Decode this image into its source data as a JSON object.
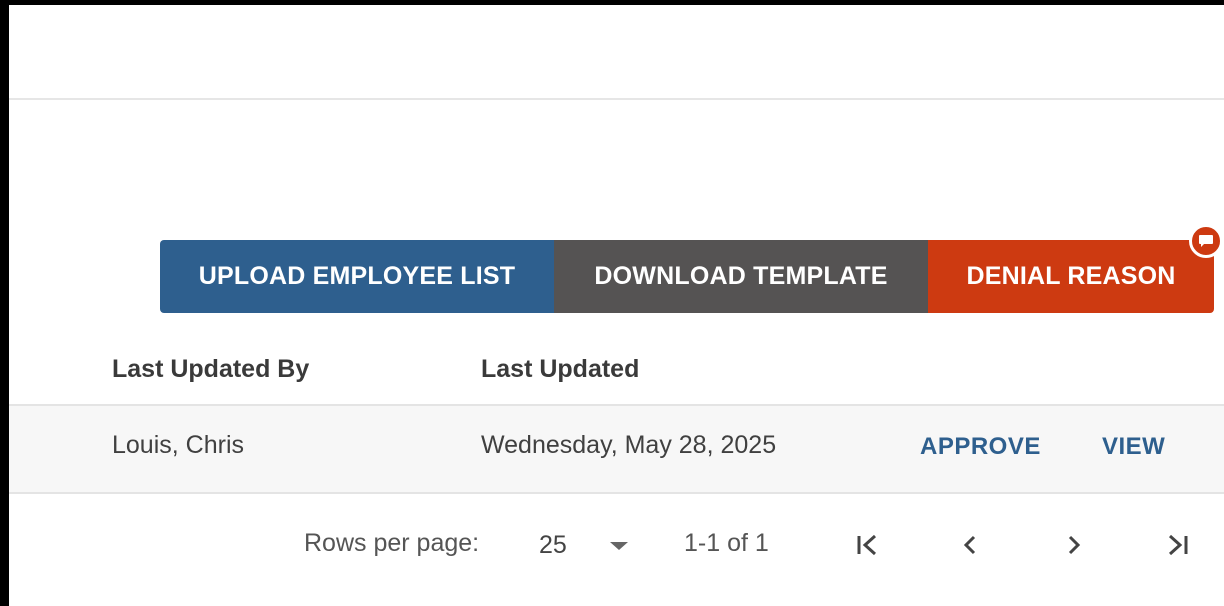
{
  "toolbar": {
    "upload_label": "UPLOAD EMPLOYEE LIST",
    "download_label": "DOWNLOAD TEMPLATE",
    "denial_label": "DENIAL REASON",
    "denial_badge_icon": "message-icon"
  },
  "table": {
    "columns": [
      "Last Updated By",
      "Last Updated"
    ],
    "rows": [
      {
        "last_updated_by": "Louis, Chris",
        "last_updated": "Wednesday, May 28, 2025",
        "actions": [
          "APPROVE",
          "VIEW"
        ]
      }
    ]
  },
  "pagination": {
    "rows_per_page_label": "Rows per page:",
    "rows_per_page_value": "25",
    "range_text": "1-1 of 1"
  },
  "colors": {
    "primary": "#2e5f8e",
    "secondary": "#555353",
    "danger": "#cd3a11"
  }
}
